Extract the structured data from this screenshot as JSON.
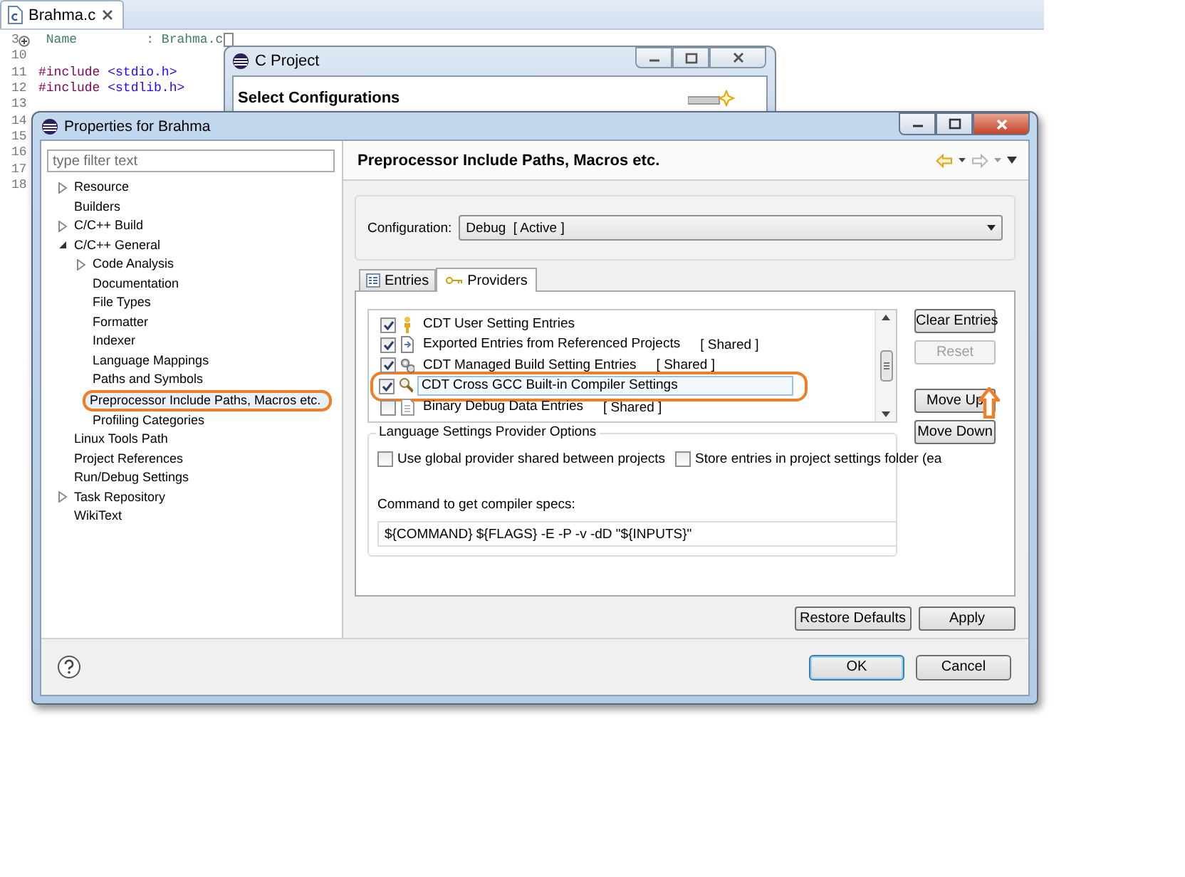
{
  "editor": {
    "tab": {
      "label": "Brahma.c"
    },
    "lines": [
      {
        "number": "3",
        "folded": true,
        "tokens": [
          {
            "kind": "comment",
            "text": " Name         : Brahma.c"
          }
        ]
      },
      {
        "number": "10",
        "folded": false
      },
      {
        "number": "11",
        "folded": false,
        "tokens": [
          {
            "kind": "keyword",
            "text": "#include"
          },
          {
            "kind": "header",
            "text": "<stdio.h>"
          }
        ]
      },
      {
        "number": "12",
        "folded": false,
        "tokens": [
          {
            "kind": "keyword",
            "text": "#include"
          },
          {
            "kind": "header",
            "text": "<stdlib.h>"
          }
        ]
      },
      {
        "number": "13",
        "folded": false
      },
      {
        "number": "14",
        "folded": false
      },
      {
        "number": "15",
        "folded": false
      },
      {
        "number": "16",
        "folded": false
      },
      {
        "number": "17",
        "folded": false
      },
      {
        "number": "18",
        "folded": false
      }
    ]
  },
  "c_project_dialog": {
    "title": "C Project",
    "heading": "Select Configurations"
  },
  "properties_dialog": {
    "title": "Properties for Brahma",
    "filter": {
      "placeholder": "type filter text"
    },
    "tree": [
      {
        "label": "Resource",
        "expanded": false,
        "selected": false,
        "highlighted": false
      },
      {
        "label": "Builders",
        "selected": false,
        "highlighted": false
      },
      {
        "label": "C/C++ Build",
        "expanded": false,
        "selected": false,
        "highlighted": false
      },
      {
        "label": "C/C++ General",
        "expanded": true,
        "selected": false,
        "highlighted": false,
        "children": [
          {
            "label": "Code Analysis",
            "expanded": false,
            "selected": false,
            "highlighted": false
          },
          {
            "label": "Documentation",
            "selected": false,
            "highlighted": false
          },
          {
            "label": "File Types",
            "selected": false,
            "highlighted": false
          },
          {
            "label": "Formatter",
            "selected": false,
            "highlighted": false
          },
          {
            "label": "Indexer",
            "selected": false,
            "highlighted": false
          },
          {
            "label": "Language Mappings",
            "selected": false,
            "highlighted": false
          },
          {
            "label": "Paths and Symbols",
            "selected": false,
            "highlighted": false
          },
          {
            "label": "Preprocessor Include Paths, Macros etc.",
            "selected": true,
            "highlighted": true
          },
          {
            "label": "Profiling Categories",
            "selected": false,
            "highlighted": false
          }
        ]
      },
      {
        "label": "Linux Tools Path",
        "selected": false,
        "highlighted": false
      },
      {
        "label": "Project References",
        "selected": false,
        "highlighted": false
      },
      {
        "label": "Run/Debug Settings",
        "selected": false,
        "highlighted": false
      },
      {
        "label": "Task Repository",
        "expanded": false,
        "selected": false,
        "highlighted": false
      },
      {
        "label": "WikiText",
        "selected": false,
        "highlighted": false
      }
    ],
    "page_title": "Preprocessor Include Paths, Macros etc.",
    "configuration": {
      "label": "Configuration:",
      "value": "Debug  [ Active ]"
    },
    "tabs": [
      {
        "label": "Entries",
        "kind": "entries",
        "selected": false
      },
      {
        "label": "Providers",
        "kind": "providers",
        "selected": true
      }
    ],
    "providers": [
      {
        "kind": "user",
        "label": "CDT User Setting Entries",
        "checked": true,
        "selected": false,
        "highlighted": false
      },
      {
        "kind": "exported",
        "label": "Exported Entries from Referenced Projects",
        "tag": "[ Shared ]",
        "checked": true,
        "selected": false,
        "highlighted": false
      },
      {
        "kind": "managed",
        "label": "CDT Managed Build Setting Entries",
        "tag": "[ Shared ]",
        "checked": true,
        "selected": false,
        "highlighted": false
      },
      {
        "kind": "builtin",
        "label": "CDT Cross GCC Built-in Compiler Settings",
        "checked": true,
        "selected": true,
        "highlighted": true
      },
      {
        "kind": "binary",
        "label": "Binary Debug Data Entries",
        "tag": "[ Shared ]",
        "checked": false,
        "selected": false,
        "highlighted": false
      }
    ],
    "provider_buttons": [
      {
        "label": "Clear Entries",
        "disabled": false,
        "annotated": false
      },
      {
        "label": "Reset",
        "disabled": true,
        "annotated": false
      },
      {
        "label": "Move Up",
        "disabled": false,
        "annotated": true
      },
      {
        "label": "Move Down",
        "disabled": false,
        "annotated": false
      }
    ],
    "options": {
      "title": "Language Settings Provider Options",
      "checkboxes": [
        {
          "label": "Use global provider shared between projects",
          "checked": false
        },
        {
          "label": "Store entries in project settings folder (ea",
          "checked": false
        }
      ],
      "command_label": "Command to get compiler specs:",
      "command_value": "${COMMAND} ${FLAGS} -E -P -v -dD \"${INPUTS}\""
    },
    "page_buttons": [
      "Restore Defaults",
      "Apply"
    ],
    "dialog_buttons": [
      {
        "label": "OK",
        "default": true
      },
      {
        "label": "Cancel",
        "default": false
      }
    ]
  }
}
